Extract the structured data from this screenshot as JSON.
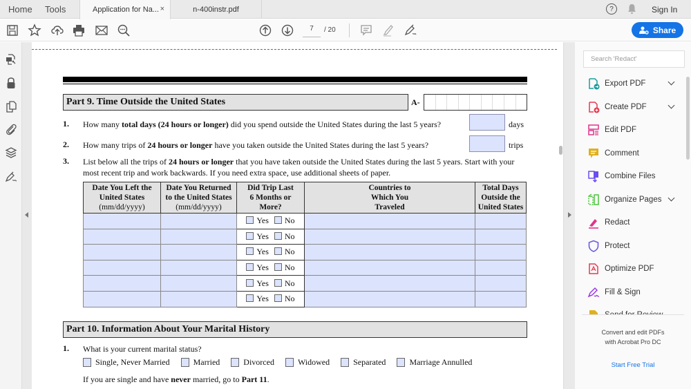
{
  "tabbar": {
    "home": "Home",
    "tools": "Tools",
    "tabs": [
      {
        "label": "Application for Na...",
        "active": true,
        "close": "×"
      },
      {
        "label": "n-400instr.pdf",
        "active": false
      }
    ],
    "help": "?",
    "sign_in": "Sign In"
  },
  "toolbar": {
    "icons": [
      "save-icon",
      "bookmark-star-icon",
      "upload-cloud-icon",
      "print-icon",
      "email-icon",
      "find-zoom-icon",
      "page-up-icon",
      "page-down-icon",
      "comment-icon",
      "highlight-icon",
      "sign-icon"
    ],
    "current_page": "7",
    "total_pages": "/ 20",
    "share_label": "Share",
    "accent": "#1473e6"
  },
  "left_rail": {
    "icons": [
      "export-redact-icon",
      "lock-icon",
      "pages-icon",
      "attachment-icon",
      "layers-icon",
      "signature-icon"
    ]
  },
  "document": {
    "part9": {
      "title": "Part 9.  Time Outside the United States",
      "a_number_label": "A-",
      "a_number_cells": 9,
      "q1": {
        "num": "1.",
        "text_html": "How many <b>total days (24 hours or longer)</b> did you spend outside the United States during the last 5 years?",
        "unit": "days",
        "value": ""
      },
      "q2": {
        "num": "2.",
        "text_html": "How many trips of <b>24 hours or longer</b> have you taken outside the United States during the last 5 years?",
        "unit": "trips",
        "value": ""
      },
      "q3": {
        "num": "3.",
        "text_html": "List below all the trips of <b>24 hours or longer</b> that you have taken outside the United States during the last 5 years.  Start with your most recent trip and work backwards.  If you need extra space, use additional sheets of paper."
      },
      "table": {
        "headers": [
          {
            "line1": "Date You Left the",
            "line2": "United States",
            "line3": "(mm/dd/yyyy)"
          },
          {
            "line1": "Date You Returned",
            "line2": "to the United States",
            "line3": "(mm/dd/yyyy)"
          },
          {
            "line1": "Did Trip Last",
            "line2": "6 Months or",
            "line3": "More?"
          },
          {
            "line1": "Countries to",
            "line2": "Which You",
            "line3": "Traveled"
          },
          {
            "line1": "Total Days",
            "line2": "Outside the",
            "line3": "United States"
          }
        ],
        "yes_label": "Yes",
        "no_label": "No",
        "rows": [
          {
            "left": "",
            "returned": "",
            "yes": false,
            "no": false,
            "countries": "",
            "days": ""
          },
          {
            "left": "",
            "returned": "",
            "yes": false,
            "no": false,
            "countries": "",
            "days": ""
          },
          {
            "left": "",
            "returned": "",
            "yes": false,
            "no": false,
            "countries": "",
            "days": ""
          },
          {
            "left": "",
            "returned": "",
            "yes": false,
            "no": false,
            "countries": "",
            "days": ""
          },
          {
            "left": "",
            "returned": "",
            "yes": false,
            "no": false,
            "countries": "",
            "days": ""
          },
          {
            "left": "",
            "returned": "",
            "yes": false,
            "no": false,
            "countries": "",
            "days": ""
          }
        ]
      }
    },
    "part10": {
      "title": "Part 10.  Information About Your Marital History",
      "q1": {
        "num": "1.",
        "text": "What is your current marital status?"
      },
      "options": [
        "Single, Never Married",
        "Married",
        "Divorced",
        "Widowed",
        "Separated",
        "Marriage Annulled"
      ],
      "note_html": "If you are single and have <b>never</b> married, go to <b>Part 11</b>."
    }
  },
  "right_panel": {
    "search_placeholder": "Search 'Redact'",
    "tools": [
      {
        "label": "Export PDF",
        "icon": "export-pdf-icon",
        "color": "#1a9c9c",
        "expandable": true
      },
      {
        "label": "Create PDF",
        "icon": "create-pdf-icon",
        "color": "#e8384f",
        "expandable": true
      },
      {
        "label": "Edit PDF",
        "icon": "edit-pdf-icon",
        "color": "#e0338b",
        "expandable": false
      },
      {
        "label": "Comment",
        "icon": "comment-icon",
        "color": "#e0b01a",
        "expandable": false
      },
      {
        "label": "Combine Files",
        "icon": "combine-files-icon",
        "color": "#6a4cf0",
        "expandable": false
      },
      {
        "label": "Organize Pages",
        "icon": "organize-pages-icon",
        "color": "#4bc43a",
        "expandable": true
      },
      {
        "label": "Redact",
        "icon": "redact-icon",
        "color": "#e0338b",
        "expandable": false
      },
      {
        "label": "Protect",
        "icon": "protect-icon",
        "color": "#6a5ce0",
        "expandable": false
      },
      {
        "label": "Optimize PDF",
        "icon": "optimize-pdf-icon",
        "color": "#e8384f",
        "expandable": false
      },
      {
        "label": "Fill & Sign",
        "icon": "fill-sign-icon",
        "color": "#9b3ae0",
        "expandable": false
      },
      {
        "label": "Send for Review",
        "icon": "send-review-icon",
        "color": "#e0b01a",
        "expandable": false
      }
    ],
    "promo_line1": "Convert and edit PDFs",
    "promo_line2": "with Acrobat Pro DC",
    "trial_label": "Start Free Trial"
  }
}
